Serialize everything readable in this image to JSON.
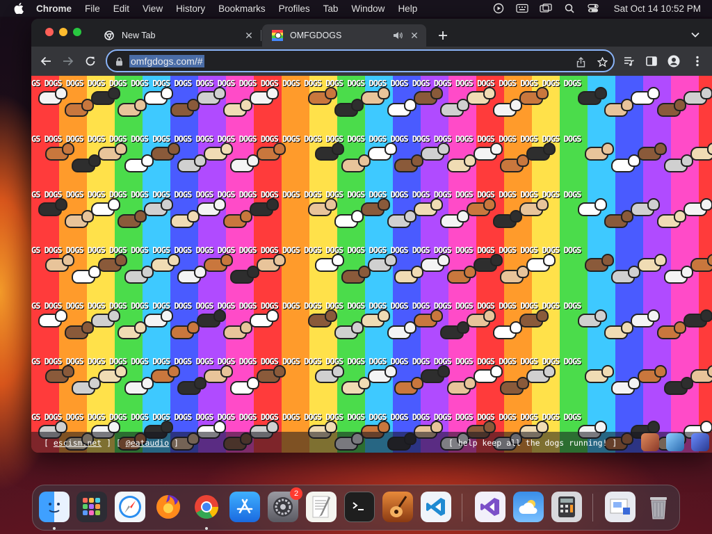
{
  "menubar": {
    "app_name": "Chrome",
    "items": [
      "File",
      "Edit",
      "View",
      "History",
      "Bookmarks",
      "Profiles",
      "Tab",
      "Window",
      "Help"
    ],
    "clock": "Sat Oct 14  10:52 PM"
  },
  "browser": {
    "tabs": [
      {
        "title": "New Tab",
        "icon": "chrome-icon",
        "active": false
      },
      {
        "title": "OMFGDOGS",
        "icon": "omfgdogs-favicon",
        "active": true
      }
    ],
    "address_bar": {
      "url": "omfgdogs.com/#"
    }
  },
  "page": {
    "band_text": "GS DOGS DOGS DOGS DOGS DOGS DOGS DOGS DOGS DOGS DOGS DOGS DOGS DOGS DOGS DOGS DOGS DOGS DOGS DOGS DOGS DOGS DOGS DOGS DOGS DOGS",
    "footer": {
      "open_bracket": "[",
      "link1": "escism.net",
      "mid": "] [",
      "link2": "@eataudio",
      "close_bracket": "]",
      "right_text": "[ help keep all the dogs running! ]"
    }
  },
  "dock": {
    "apps": [
      "Finder",
      "Launchpad",
      "Safari",
      "Firefox",
      "Google Chrome",
      "App Store",
      "System Settings",
      "TextEdit",
      "Terminal",
      "GarageBand",
      "Visual Studio Code",
      "Visual Studio",
      "Weather",
      "Calculator",
      "Preview",
      "Trash"
    ],
    "settings_badge": "2"
  },
  "colors": {
    "accent": "#8ab4f8",
    "url_highlight": "#4a6da7",
    "tab_active": "#35363a",
    "tab_strip": "#202124"
  }
}
